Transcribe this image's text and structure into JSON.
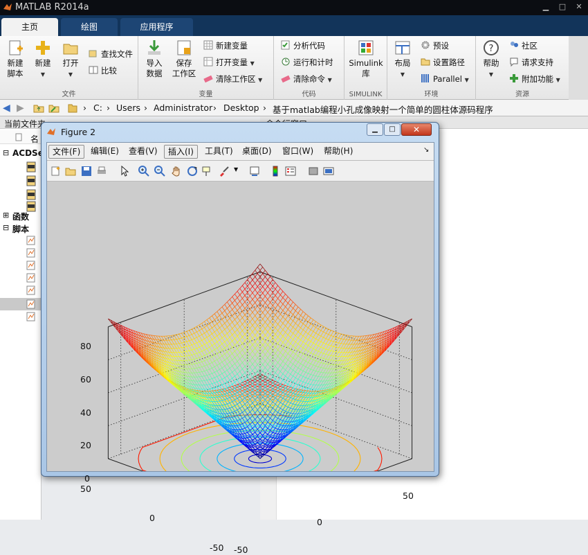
{
  "app": {
    "title": "MATLAB R2014a"
  },
  "tabs": [
    {
      "label": "主页",
      "active": true
    },
    {
      "label": "绘图",
      "active": false
    },
    {
      "label": "应用程序",
      "active": false
    }
  ],
  "ribbon": {
    "file": {
      "label": "文件",
      "new_script": "新建\n脚本",
      "new": "新建",
      "open": "打开",
      "find_files": "查找文件",
      "compare": "比较"
    },
    "variable": {
      "label": "变量",
      "import": "导入\n数据",
      "save_workspace": "保存\n工作区",
      "new_variable": "新建变量",
      "open_variable": "打开变量",
      "clear_workspace": "清除工作区"
    },
    "code": {
      "label": "代码",
      "analyze": "分析代码",
      "run_time": "运行和计时",
      "clear_commands": "清除命令"
    },
    "simulink": {
      "label": "SIMULINK",
      "library": "Simulink\n库"
    },
    "environment": {
      "label": "环境",
      "layout": "布局",
      "preferences": "预设",
      "set_path": "设置路径",
      "parallel": "Parallel"
    },
    "resources": {
      "label": "资源",
      "help": "帮助",
      "community": "社区",
      "request_support": "请求支持",
      "addons": "附加功能"
    }
  },
  "address": {
    "path": [
      "C:",
      "Users",
      "Administrator",
      "Desktop",
      "基于matlab编程小孔成像映射一个简单的圆柱体源码程序"
    ]
  },
  "panels": {
    "current_folder": "当前文件夹",
    "command_window": "命令行窗口",
    "name_col": "名",
    "tree": [
      "ACDSe",
      "函数",
      "脚本"
    ]
  },
  "figure": {
    "title": "Figure 2",
    "menus": [
      "文件(F)",
      "编辑(E)",
      "查看(V)",
      "插入(I)",
      "工具(T)",
      "桌面(D)",
      "窗口(W)",
      "帮助(H)"
    ],
    "z_ticks": [
      "80",
      "60",
      "40",
      "20",
      "0"
    ],
    "y_ticks": [
      "50",
      "0",
      "-50"
    ],
    "x_ticks": [
      "-50",
      "0",
      "50"
    ]
  },
  "colors": {
    "accent": "#12345a",
    "tab_blue": "#1d4574"
  }
}
